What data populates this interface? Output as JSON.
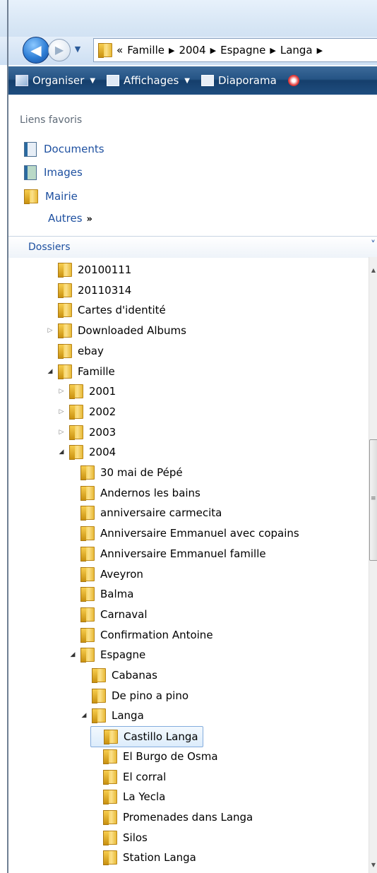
{
  "address": {
    "overflow": "«",
    "crumbs": [
      "Famille",
      "2004",
      "Espagne",
      "Langa"
    ],
    "trailing_separator": "▶"
  },
  "toolbar": {
    "organize": "Organiser",
    "views": "Affichages",
    "slideshow": "Diaporama"
  },
  "favorites": {
    "title": "Liens favoris",
    "links": [
      "Documents",
      "Images",
      "Mairie"
    ],
    "more": "Autres",
    "more_chevron": "»"
  },
  "folders": {
    "title": "Dossiers",
    "collapse_glyph": "˅"
  },
  "tree": {
    "items": [
      {
        "label": "20100111",
        "level": 1,
        "expander": "none"
      },
      {
        "label": "20110314",
        "level": 1,
        "expander": "none"
      },
      {
        "label": "Cartes d'identité",
        "level": 1,
        "expander": "none"
      },
      {
        "label": "Downloaded Albums",
        "level": 1,
        "expander": "collapsed"
      },
      {
        "label": "ebay",
        "level": 1,
        "expander": "none"
      },
      {
        "label": "Famille",
        "level": 1,
        "expander": "expanded"
      },
      {
        "label": "2001",
        "level": 2,
        "expander": "collapsed"
      },
      {
        "label": "2002",
        "level": 2,
        "expander": "collapsed"
      },
      {
        "label": "2003",
        "level": 2,
        "expander": "collapsed"
      },
      {
        "label": "2004",
        "level": 2,
        "expander": "expanded"
      },
      {
        "label": "30 mai de Pépé",
        "level": 3,
        "expander": "none"
      },
      {
        "label": "Andernos les bains",
        "level": 3,
        "expander": "none"
      },
      {
        "label": "anniversaire carmecita",
        "level": 3,
        "expander": "none"
      },
      {
        "label": "Anniversaire Emmanuel avec copains",
        "level": 3,
        "expander": "none"
      },
      {
        "label": "Anniversaire Emmanuel famille",
        "level": 3,
        "expander": "none"
      },
      {
        "label": "Aveyron",
        "level": 3,
        "expander": "none"
      },
      {
        "label": "Balma",
        "level": 3,
        "expander": "none"
      },
      {
        "label": "Carnaval",
        "level": 3,
        "expander": "none"
      },
      {
        "label": "Confirmation Antoine",
        "level": 3,
        "expander": "none"
      },
      {
        "label": "Espagne",
        "level": 3,
        "expander": "expanded"
      },
      {
        "label": "Cabanas",
        "level": 4,
        "expander": "none"
      },
      {
        "label": "De pino a pino",
        "level": 4,
        "expander": "none"
      },
      {
        "label": "Langa",
        "level": 4,
        "expander": "expanded"
      },
      {
        "label": "Castillo Langa",
        "level": 5,
        "expander": "none",
        "selected": true
      },
      {
        "label": "El Burgo de Osma",
        "level": 5,
        "expander": "none"
      },
      {
        "label": "El corral",
        "level": 5,
        "expander": "none"
      },
      {
        "label": "La Yecla",
        "level": 5,
        "expander": "none"
      },
      {
        "label": "Promenades dans Langa",
        "level": 5,
        "expander": "none"
      },
      {
        "label": "Silos",
        "level": 5,
        "expander": "none"
      },
      {
        "label": "Station Langa",
        "level": 5,
        "expander": "none"
      }
    ]
  },
  "scroll": {
    "position": 0.45
  },
  "colors": {
    "link": "#1e50a0",
    "toolbar": "#255485",
    "selection_border": "#84acdd"
  }
}
